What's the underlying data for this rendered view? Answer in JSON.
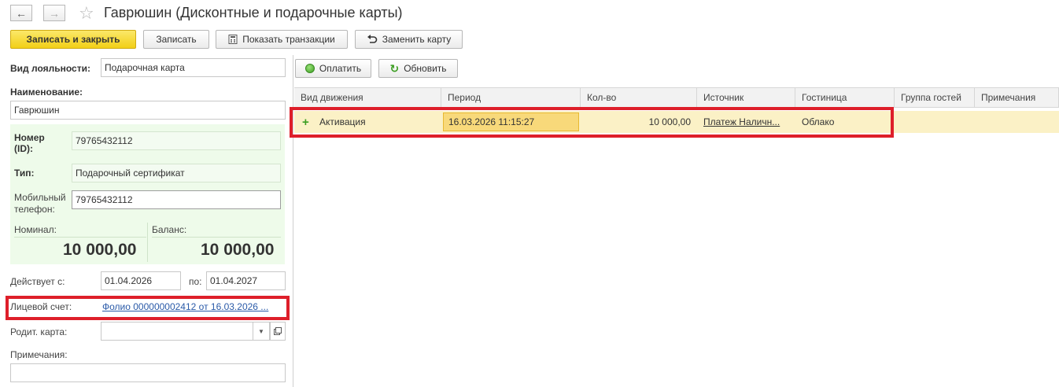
{
  "window": {
    "title": "Гаврюшин (Дисконтные и подарочные карты)",
    "back_icon": "←",
    "forward_icon": "→",
    "star_icon": "☆"
  },
  "toolbar": {
    "save_close": "Записать и закрыть",
    "save": "Записать",
    "show_transactions": "Показать транзакции",
    "replace_card": "Заменить карту"
  },
  "form": {
    "loyalty_label": "Вид лояльности:",
    "loyalty_value": "Подарочная карта",
    "name_label": "Наименование:",
    "name_value": "Гаврюшин",
    "number_label": "Номер (ID):",
    "number_value": "79765432112",
    "type_label": "Тип:",
    "type_value": "Подарочный сертификат",
    "phone_label": "Мобильный телефон:",
    "phone_value": "79765432112",
    "nominal_label": "Номинал:",
    "nominal_value": "10 000,00",
    "balance_label": "Баланс:",
    "balance_value": "10 000,00",
    "valid_from_label": "Действует с:",
    "valid_from_value": "01.04.2026",
    "valid_to_label": "по:",
    "valid_to_value": "01.04.2027",
    "account_label": "Лицевой счет:",
    "account_value": "Фолио 000000002412 от 16.03.2026 ...",
    "parent_card_label": "Родит. карта:",
    "parent_card_value": "",
    "notes_label": "Примечания:",
    "notes_value": ""
  },
  "right_toolbar": {
    "pay": "Оплатить",
    "refresh": "Обновить"
  },
  "table": {
    "columns": [
      "Вид движения",
      "Период",
      "Кол-во",
      "Источник",
      "Гостиница",
      "Группа гостей",
      "Примечания"
    ],
    "rows": [
      {
        "movement": "Активация",
        "period": "16.03.2026 11:15:27",
        "qty": "10 000,00",
        "source": "Платеж Наличн...",
        "hotel": "Облако",
        "guest_group": "",
        "notes": ""
      }
    ]
  },
  "colors": {
    "highlight_red": "#de1f2a",
    "primary_yellow": "#f2cf16",
    "row_highlight": "#fbf1c6",
    "green_panel": "#eefbea"
  }
}
